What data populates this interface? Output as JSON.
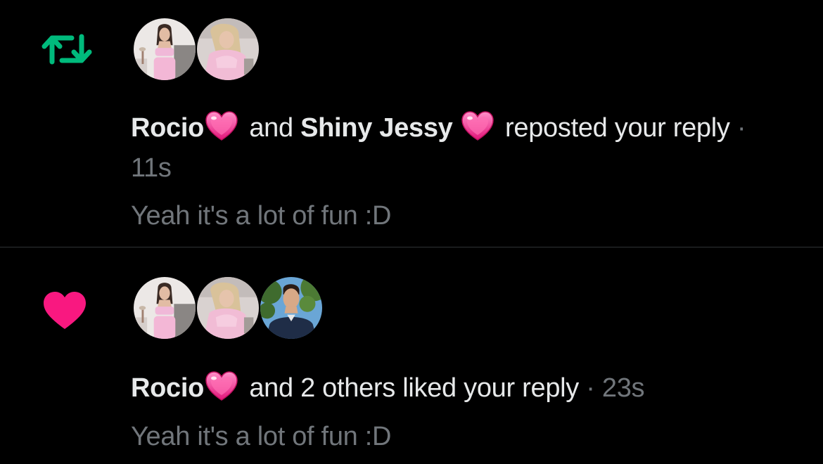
{
  "notifications": [
    {
      "type": "repost",
      "icon": "repost-icon",
      "icon_color": "#00ba7c",
      "avatars": [
        "avatar-rocio",
        "avatar-shiny-jessy"
      ],
      "user1": "Rocio",
      "user1_emoji": "💗",
      "connector": " and ",
      "user2": "Shiny Jessy",
      "user2_emoji": "💗",
      "action": " reposted your reply",
      "separator": " · ",
      "time": "11s",
      "snippet": "Yeah it's a lot of fun :D"
    },
    {
      "type": "like",
      "icon": "heart-icon",
      "icon_color": "#f91880",
      "avatars": [
        "avatar-rocio",
        "avatar-shiny-jessy",
        "avatar-third-user"
      ],
      "user1": "Rocio",
      "user1_emoji": "💗",
      "action": " and 2 others liked your reply",
      "separator": " · ",
      "time": "23s",
      "snippet": "Yeah it's a lot of fun :D"
    }
  ]
}
